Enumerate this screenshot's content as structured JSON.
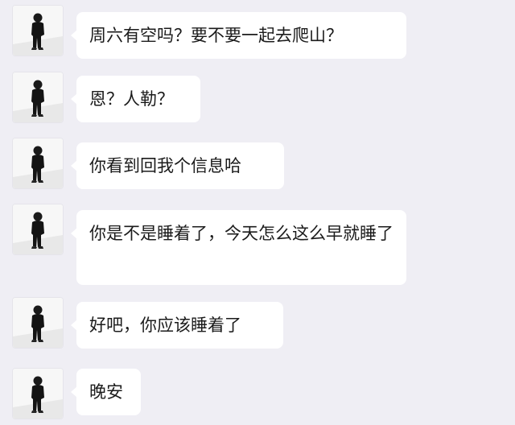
{
  "chat": {
    "background": "#efeef4",
    "bubble_color": "#ffffff",
    "messages": [
      {
        "text": "周六有空吗？要不要一起去爬山？",
        "avatar": "person-photo-avatar"
      },
      {
        "text": "恩？人勒？",
        "avatar": "person-photo-avatar"
      },
      {
        "text": "你看到回我个信息哈",
        "avatar": "person-photo-avatar"
      },
      {
        "text": "你是不是睡着了，今天怎么这么早就睡了",
        "avatar": "person-photo-avatar"
      },
      {
        "text": "好吧，你应该睡着了",
        "avatar": "person-photo-avatar"
      },
      {
        "text": "晚安",
        "avatar": "person-photo-avatar"
      }
    ]
  }
}
